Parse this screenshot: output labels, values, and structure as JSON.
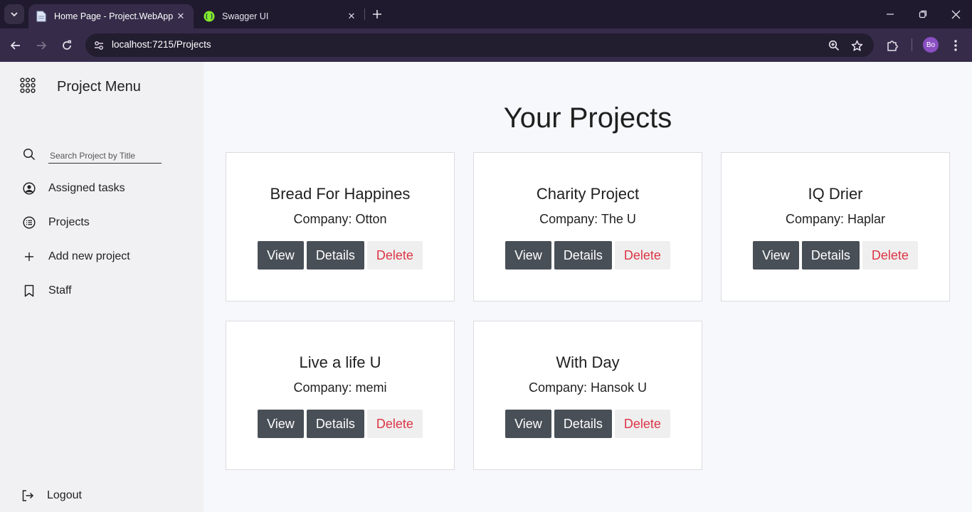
{
  "browser": {
    "tabs": [
      {
        "title": "Home Page - Project.WebApp",
        "active": true,
        "icon": "document-icon"
      },
      {
        "title": "Swagger UI",
        "active": false,
        "icon": "swagger-icon"
      }
    ],
    "url": "localhost:7215/Projects",
    "profile_initials": "Bo",
    "colors": {
      "frame": "#201a2e",
      "toolbar": "#362c4a",
      "omnibox": "#231d30",
      "profile": "#8a4fc2",
      "swagger": "#85ea2d"
    }
  },
  "sidebar": {
    "title": "Project Menu",
    "search_placeholder": "Search Project by Title",
    "items": [
      {
        "label": "Assigned tasks",
        "icon": "user-circle-icon"
      },
      {
        "label": "Projects",
        "icon": "list-circle-icon"
      },
      {
        "label": "Add new project",
        "icon": "plus-icon"
      },
      {
        "label": "Staff",
        "icon": "bookmark-icon"
      }
    ],
    "logout_label": "Logout"
  },
  "main": {
    "title": "Your Projects",
    "button_labels": {
      "view": "View",
      "details": "Details",
      "delete": "Delete"
    },
    "projects": [
      {
        "title": "Bread For Happines",
        "company": "Company: Otton"
      },
      {
        "title": "Charity Project",
        "company": "Company: The U"
      },
      {
        "title": "IQ Drier",
        "company": "Company: Haplar"
      },
      {
        "title": "Live a life U",
        "company": "Company: memi"
      },
      {
        "title": "With Day",
        "company": "Company: Hansok U"
      }
    ],
    "colors": {
      "button_dark": "#494f57",
      "delete_text": "#dc3545",
      "delete_bg": "#efefef"
    }
  }
}
